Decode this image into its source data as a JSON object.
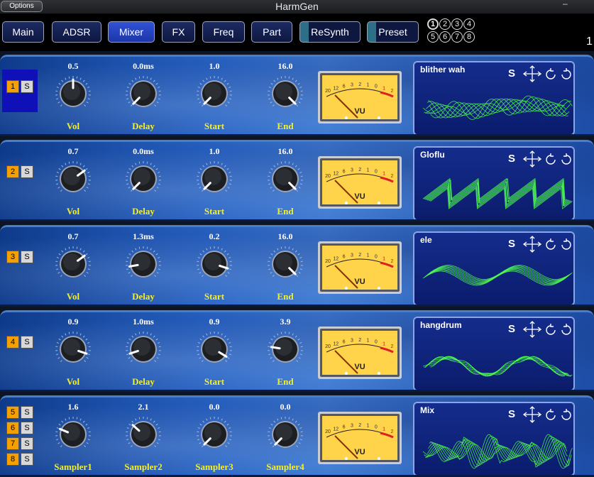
{
  "window": {
    "title": "HarmGen",
    "options_label": "Options",
    "minimize_glyph": "–"
  },
  "tabs": [
    {
      "label": "Main",
      "active": false
    },
    {
      "label": "ADSR",
      "active": false
    },
    {
      "label": "Mixer",
      "active": true
    },
    {
      "label": "FX",
      "active": false
    },
    {
      "label": "Freq",
      "active": false
    },
    {
      "label": "Part",
      "active": false
    },
    {
      "label": "ReSynth",
      "active": false
    },
    {
      "label": "Preset",
      "active": false
    }
  ],
  "preset_slots": [
    "1",
    "2",
    "3",
    "4",
    "5",
    "6",
    "7",
    "8"
  ],
  "preset_selected": "1",
  "edge_number": "1",
  "colors": {
    "accent": "#3152d6",
    "label": "#f5ef2a",
    "part": "#f5a000",
    "scope_wave": "#4dff4d",
    "vu_face": "#ffd34a"
  },
  "rows": [
    {
      "parts": [
        {
          "num": "1",
          "solo": "S"
        }
      ],
      "knobs": [
        {
          "label": "Vol",
          "value": "0.5",
          "level": 0.5
        },
        {
          "label": "Delay",
          "value": "0.0ms",
          "level": 0.0
        },
        {
          "label": "Start",
          "value": "1.0",
          "level": 0.0
        },
        {
          "label": "End",
          "value": "16.0",
          "level": 1.0
        }
      ],
      "vu": {
        "scale": [
          "20",
          "12",
          "6",
          "3",
          "2",
          "1",
          "0",
          "1",
          "2"
        ],
        "label": "VU"
      },
      "scope": {
        "name": "blither wah",
        "solo": "S"
      }
    },
    {
      "parts": [
        {
          "num": "2",
          "solo": "S"
        }
      ],
      "knobs": [
        {
          "label": "Vol",
          "value": "0.7",
          "level": 0.7
        },
        {
          "label": "Delay",
          "value": "0.0ms",
          "level": 0.0
        },
        {
          "label": "Start",
          "value": "1.0",
          "level": 0.0
        },
        {
          "label": "End",
          "value": "16.0",
          "level": 1.0
        }
      ],
      "vu": {
        "scale": [
          "20",
          "12",
          "6",
          "3",
          "2",
          "1",
          "0",
          "1",
          "2"
        ],
        "label": "VU"
      },
      "scope": {
        "name": "Gloflu",
        "solo": "S"
      }
    },
    {
      "parts": [
        {
          "num": "3",
          "solo": "S"
        }
      ],
      "knobs": [
        {
          "label": "Vol",
          "value": "0.7",
          "level": 0.7
        },
        {
          "label": "Delay",
          "value": "1.3ms",
          "level": 0.13
        },
        {
          "label": "Start",
          "value": "0.2",
          "level": 0.9
        },
        {
          "label": "End",
          "value": "16.0",
          "level": 1.0
        }
      ],
      "vu": {
        "scale": [
          "20",
          "12",
          "6",
          "3",
          "2",
          "1",
          "0",
          "1",
          "2"
        ],
        "label": "VU"
      },
      "scope": {
        "name": "ele",
        "solo": "S"
      }
    },
    {
      "parts": [
        {
          "num": "4",
          "solo": "S"
        }
      ],
      "knobs": [
        {
          "label": "Vol",
          "value": "0.9",
          "level": 0.9
        },
        {
          "label": "Delay",
          "value": "1.0ms",
          "level": 0.1
        },
        {
          "label": "Start",
          "value": "0.9",
          "level": 0.95
        },
        {
          "label": "End",
          "value": "3.9",
          "level": 0.2
        }
      ],
      "vu": {
        "scale": [
          "20",
          "12",
          "6",
          "3",
          "2",
          "1",
          "0",
          "1",
          "2"
        ],
        "label": "VU"
      },
      "scope": {
        "name": "hangdrum",
        "solo": "S"
      }
    },
    {
      "parts": [
        {
          "num": "5",
          "solo": "S"
        },
        {
          "num": "6",
          "solo": "S"
        },
        {
          "num": "7",
          "solo": "S"
        },
        {
          "num": "8",
          "solo": "S"
        }
      ],
      "knobs": [
        {
          "label": "Sampler1",
          "value": "1.6",
          "level": 0.25
        },
        {
          "label": "Sampler2",
          "value": "2.1",
          "level": 0.32
        },
        {
          "label": "Sampler3",
          "value": "0.0",
          "level": 0.0
        },
        {
          "label": "Sampler4",
          "value": "0.0",
          "level": 0.0
        }
      ],
      "vu": {
        "scale": [
          "20",
          "12",
          "6",
          "3",
          "2",
          "1",
          "0",
          "1",
          "2"
        ],
        "label": "VU"
      },
      "scope": {
        "name": "Mix",
        "solo": "S"
      }
    }
  ]
}
